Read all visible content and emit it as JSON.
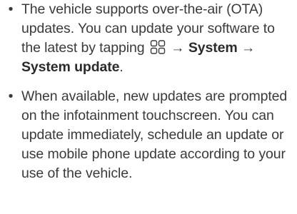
{
  "bullets": [
    {
      "symbol": "•",
      "part1": "The vehicle supports over-the-air (OTA) updates. You can update your software to the latest by tapping ",
      "icon": "grid-menu-icon",
      "arrow1": " → ",
      "bold1": "System",
      "arrow2": " → ",
      "bold2": "System update",
      "end": "."
    },
    {
      "symbol": "•",
      "text": "When available, new updates are prompted on the infotainment touchscreen. You can update immediately, schedule an update or use mobile phone update according to your use of the vehicle."
    }
  ]
}
